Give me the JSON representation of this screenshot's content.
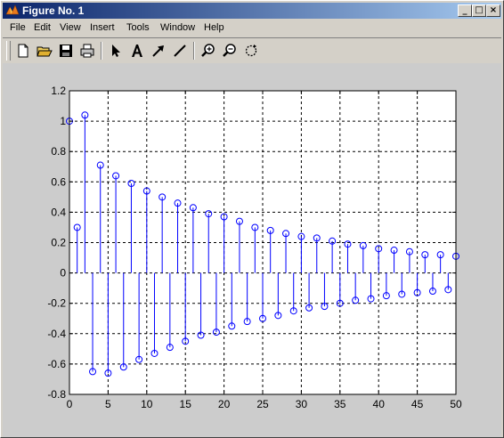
{
  "window": {
    "title": "Figure No. 1",
    "icon": "matlab-icon",
    "controls": [
      "minimize-icon",
      "maximize-icon",
      "close-icon"
    ]
  },
  "menu": [
    "File",
    "Edit",
    "View",
    "Insert",
    "Tools",
    "Window",
    "Help"
  ],
  "toolbar": [
    {
      "name": "new-figure-button",
      "icon": "new-document-icon"
    },
    {
      "name": "open-file-button",
      "icon": "open-folder-icon"
    },
    {
      "name": "save-button",
      "icon": "floppy-disk-icon"
    },
    {
      "name": "print-button",
      "icon": "printer-icon"
    },
    {
      "name": "edit-plot-button",
      "icon": "arrow-cursor-icon"
    },
    {
      "name": "insert-text-button",
      "icon": "text-A-icon"
    },
    {
      "name": "insert-arrow-button",
      "icon": "arrow-icon"
    },
    {
      "name": "insert-line-button",
      "icon": "line-icon"
    },
    {
      "name": "zoom-in-button",
      "icon": "zoom-in-icon"
    },
    {
      "name": "zoom-out-button",
      "icon": "zoom-out-icon"
    },
    {
      "name": "rotate-3d-button",
      "icon": "rotate-icon"
    }
  ],
  "colors": {
    "figure_background": "#cccccc",
    "axes_background": "#ffffff",
    "series": "#0000ff",
    "title_gradient_start": "#0a246a",
    "title_gradient_end": "#a6caf0"
  },
  "chart_data": {
    "type": "stem",
    "grid": true,
    "xlim": [
      0,
      50
    ],
    "ylim": [
      -0.8,
      1.2
    ],
    "xticks": [
      0,
      5,
      10,
      15,
      20,
      25,
      30,
      35,
      40,
      45,
      50
    ],
    "yticks": [
      -0.8,
      -0.6,
      -0.4,
      -0.2,
      0,
      0.2,
      0.4,
      0.6,
      0.8,
      1,
      1.2
    ],
    "ytick_labels": [
      "-0.8",
      "-0.6",
      "-0.4",
      "-0.2",
      "0",
      "0.2",
      "0.4",
      "0.6",
      "0.8",
      "1",
      "1.2"
    ],
    "marker": "open-circle",
    "x": [
      0,
      1,
      2,
      3,
      4,
      5,
      6,
      7,
      8,
      9,
      10,
      11,
      12,
      13,
      14,
      15,
      16,
      17,
      18,
      19,
      20,
      21,
      22,
      23,
      24,
      25,
      26,
      27,
      28,
      29,
      30,
      31,
      32,
      33,
      34,
      35,
      36,
      37,
      38,
      39,
      40,
      41,
      42,
      43,
      44,
      45,
      46,
      47,
      48,
      49,
      50
    ],
    "y": [
      1.0,
      0.3,
      1.04,
      -0.65,
      0.71,
      -0.66,
      0.64,
      -0.62,
      0.59,
      -0.57,
      0.54,
      -0.53,
      0.5,
      -0.49,
      0.46,
      -0.45,
      0.43,
      -0.41,
      0.39,
      -0.39,
      0.37,
      -0.35,
      0.34,
      -0.32,
      0.3,
      -0.3,
      0.28,
      -0.28,
      0.26,
      -0.25,
      0.24,
      -0.23,
      0.23,
      -0.22,
      0.21,
      -0.2,
      0.19,
      -0.18,
      0.18,
      -0.17,
      0.16,
      -0.15,
      0.15,
      -0.14,
      0.14,
      -0.13,
      0.12,
      -0.12,
      0.12,
      -0.11,
      0.11
    ]
  }
}
